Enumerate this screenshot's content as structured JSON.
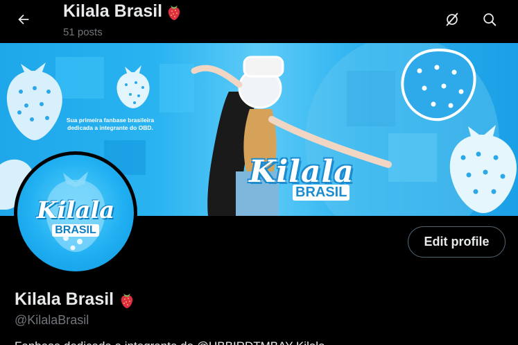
{
  "header": {
    "title": "Kilala Brasil",
    "title_emoji": "strawberry-icon",
    "posts_count": "51 posts",
    "back_icon": "arrow-left-icon",
    "grok_icon": "grok-icon",
    "search_icon": "search-icon"
  },
  "banner": {
    "caption_line1": "Sua primeira fanbase brasileira",
    "caption_line2": "dedicada a integrante do OBD.",
    "logo_big": "Kilala",
    "logo_small": "BRASIL"
  },
  "avatar": {
    "logo_big": "Kilala",
    "logo_small": "BRASIL"
  },
  "actions": {
    "edit_profile": "Edit profile"
  },
  "profile": {
    "name": "Kilala Brasil",
    "name_emoji": "strawberry-icon",
    "handle": "@KilalaBrasil",
    "bio_partial": "Fanbase dedicada a integrante do @UBBIRDTMBAY Kilala"
  },
  "colors": {
    "background": "#000000",
    "text_primary": "#e7e9ea",
    "text_secondary": "#71767b",
    "banner_blue": "#1ea7ea",
    "button_border": "#536471"
  }
}
